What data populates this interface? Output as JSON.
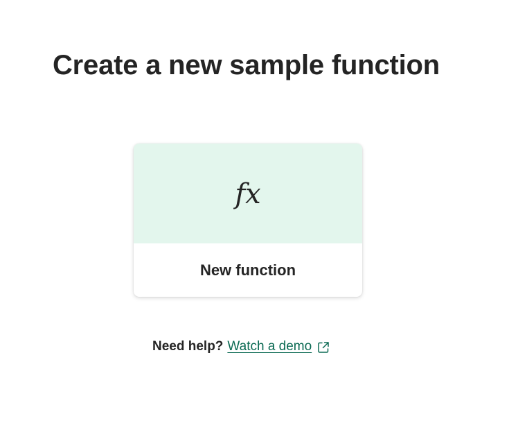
{
  "page": {
    "title": "Create a new sample function"
  },
  "card": {
    "icon": "function-fx-icon",
    "icon_glyph": "fx",
    "label": "New function",
    "accent_color": "#e3f6ed"
  },
  "help": {
    "prompt": "Need help?",
    "link_label": "Watch a demo",
    "link_icon": "external-link-icon",
    "link_color": "#0b6a53"
  }
}
